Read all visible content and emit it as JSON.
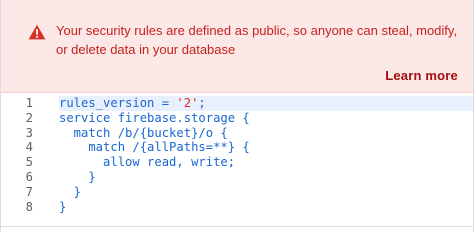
{
  "banner": {
    "message": "Your security rules are defined as public, so anyone can steal, modify, or delete data in your database",
    "learn_more": "Learn more",
    "icon": "warning-icon",
    "accent_color": "#d93025"
  },
  "editor": {
    "lines": [
      {
        "number": "1",
        "before": "rules_version = ",
        "string": "'2'",
        "after": ";"
      },
      {
        "number": "2",
        "before": "service firebase.storage {",
        "string": "",
        "after": ""
      },
      {
        "number": "3",
        "before": "  match /b/{bucket}/o {",
        "string": "",
        "after": ""
      },
      {
        "number": "4",
        "before": "    match /{allPaths=**} {",
        "string": "",
        "after": ""
      },
      {
        "number": "5",
        "before": "      allow read, write;",
        "string": "",
        "after": ""
      },
      {
        "number": "6",
        "before": "    }",
        "string": "",
        "after": ""
      },
      {
        "number": "7",
        "before": "  }",
        "string": "",
        "after": ""
      },
      {
        "number": "8",
        "before": "}",
        "string": "",
        "after": ""
      }
    ]
  }
}
